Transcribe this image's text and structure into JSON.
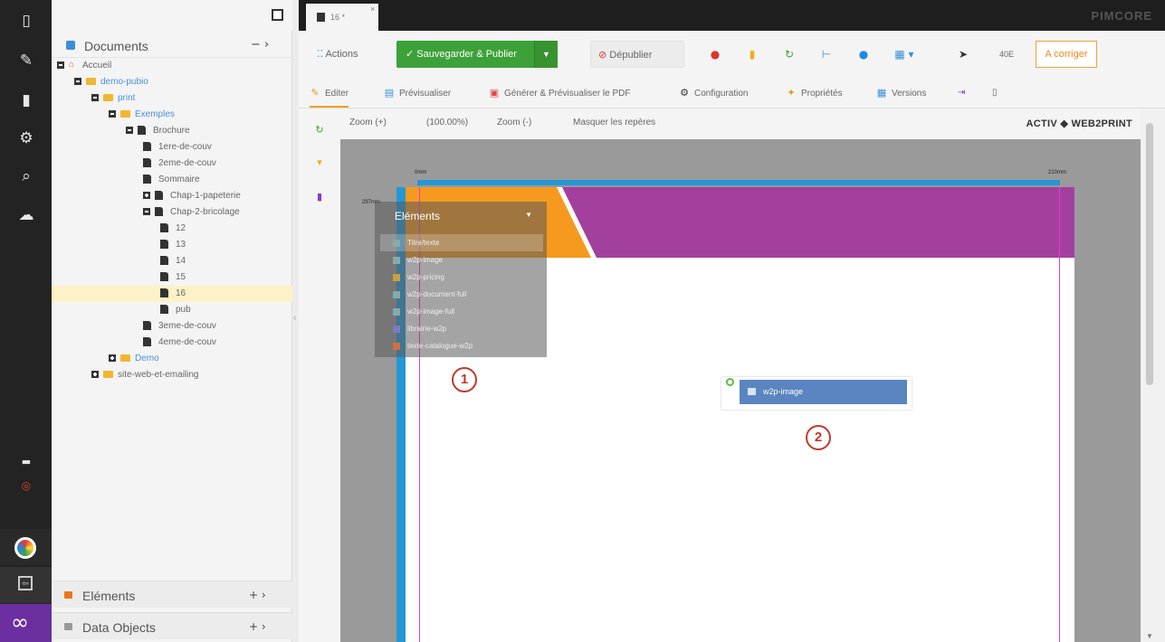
{
  "tab": {
    "title": "16 *",
    "close": "×"
  },
  "brand": "PIMCORE",
  "tree": {
    "header": "Documents",
    "header_ctl": "−  ›",
    "items": [
      {
        "label": "Accueil",
        "indent": 0,
        "kind": "home",
        "expander": "minus"
      },
      {
        "label": "demo-pubio",
        "indent": 1,
        "kind": "folder",
        "expander": "minus",
        "blue": true
      },
      {
        "label": "print",
        "indent": 2,
        "kind": "folder",
        "expander": "minus",
        "blue": true
      },
      {
        "label": "Exemples",
        "indent": 3,
        "kind": "folder",
        "expander": "minus",
        "blue": true
      },
      {
        "label": "Brochure",
        "indent": 4,
        "kind": "doc",
        "expander": "minus"
      },
      {
        "label": "1ere-de-couv",
        "indent": 5,
        "kind": "doc"
      },
      {
        "label": "2eme-de-couv",
        "indent": 5,
        "kind": "doc"
      },
      {
        "label": "Sommaire",
        "indent": 5,
        "kind": "doc"
      },
      {
        "label": "Chap-1-papeterie",
        "indent": 5,
        "kind": "doc",
        "expander": "plus"
      },
      {
        "label": "Chap-2-bricolage",
        "indent": 5,
        "kind": "doc",
        "expander": "minus"
      },
      {
        "label": "12",
        "indent": 6,
        "kind": "doc"
      },
      {
        "label": "13",
        "indent": 6,
        "kind": "doc"
      },
      {
        "label": "14",
        "indent": 6,
        "kind": "doc"
      },
      {
        "label": "15",
        "indent": 6,
        "kind": "doc"
      },
      {
        "label": "16",
        "indent": 6,
        "kind": "doc",
        "selected": true
      },
      {
        "label": "pub",
        "indent": 6,
        "kind": "doc"
      },
      {
        "label": "3eme-de-couv",
        "indent": 5,
        "kind": "doc"
      },
      {
        "label": "4eme-de-couv",
        "indent": 5,
        "kind": "doc"
      },
      {
        "label": "Demo",
        "indent": 3,
        "kind": "folder",
        "expander": "plus",
        "blue": true
      },
      {
        "label": "site-web-et-emailing",
        "indent": 2,
        "kind": "folder",
        "expander": "plus"
      }
    ],
    "footer": [
      {
        "label": "Eléments",
        "ctl": "+ ›"
      },
      {
        "label": "Data Objects",
        "ctl": "+ ›"
      }
    ]
  },
  "toolbar": {
    "actions": "Actions",
    "save_publish": "Sauvegarder & Publier",
    "unpublish": "Dépublier",
    "zoom_pct": "40E",
    "translate": "A corriger"
  },
  "subtabs": [
    {
      "label": "Editer",
      "icon": "✎",
      "active": true
    },
    {
      "label": "Prévisualiser",
      "icon": "▤"
    },
    {
      "label": "Générer & Prévisualiser le PDF",
      "icon": "▣"
    },
    {
      "label": "Configuration",
      "icon": "⚙"
    },
    {
      "label": "Propriétés",
      "icon": "✦"
    },
    {
      "label": "Versions",
      "icon": "▦"
    }
  ],
  "editor_bar": {
    "zoom_in": "Zoom (+)",
    "zoom_val": "(100.00%)",
    "zoom_out": "Zoom (-)",
    "hide_marks": "Masquer les repères",
    "logo": "ACTIV ◆ WEB2PRINT"
  },
  "ruler": {
    "left": "0mm",
    "right": "210mm",
    "side": "297mm"
  },
  "popup": {
    "title": "Eléments",
    "items": [
      "Titre/texte",
      "w2p-image",
      "w2p-pricing",
      "w2p-document-full",
      "w2p-image-full",
      "librairie-w2p",
      "texte-catalogue-w2p"
    ]
  },
  "w2p_block": "w2p-image",
  "markers": [
    "1",
    "2"
  ],
  "colors": {
    "orange": "#f59a1e",
    "purple": "#a3409e",
    "blue": "#2497d4",
    "green": "#3da13a",
    "magenta": "#e53ad4"
  }
}
